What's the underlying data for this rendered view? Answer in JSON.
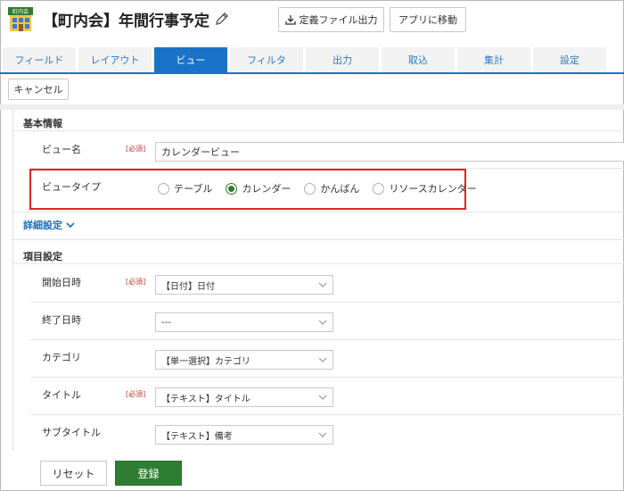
{
  "header": {
    "app_icon_label": "町内会",
    "title": "【町内会】年間行事予定",
    "export_button": "定義ファイル出力",
    "goto_app_button": "アプリに移動"
  },
  "tabs": [
    {
      "label": "フィールド",
      "active": false
    },
    {
      "label": "レイアウト",
      "active": false
    },
    {
      "label": "ビュー",
      "active": true
    },
    {
      "label": "フィルタ",
      "active": false
    },
    {
      "label": "出力",
      "active": false
    },
    {
      "label": "取込",
      "active": false
    },
    {
      "label": "集計",
      "active": false
    },
    {
      "label": "設定",
      "active": false
    }
  ],
  "cancel_button": "キャンセル",
  "basic_info": {
    "section_title": "基本情報",
    "view_name_label": "ビュー名",
    "required": "[必須]",
    "view_name_value": "カレンダービュー",
    "view_type_label": "ビュータイプ",
    "view_type_options": [
      {
        "label": "テーブル",
        "checked": false
      },
      {
        "label": "カレンダー",
        "checked": true
      },
      {
        "label": "かんばん",
        "checked": false
      },
      {
        "label": "リソースカレンダー",
        "checked": false
      }
    ]
  },
  "detail_settings": "詳細設定",
  "item_settings": {
    "section_title": "項目設定",
    "required": "[必須]",
    "fields": [
      {
        "label": "開始日時",
        "required": true,
        "value": "【日付】日付"
      },
      {
        "label": "終了日時",
        "required": false,
        "value": "---"
      },
      {
        "label": "カテゴリ",
        "required": false,
        "value": "【単一選択】カテゴリ"
      },
      {
        "label": "タイトル",
        "required": true,
        "value": "【テキスト】タイトル"
      },
      {
        "label": "サブタイトル",
        "required": false,
        "value": "【テキスト】備考"
      }
    ]
  },
  "footer": {
    "reset_button": "リセット",
    "save_button": "登録"
  },
  "colors": {
    "accent_blue": "#1a73c8",
    "save_green": "#2f7d32",
    "highlight_red": "#e32222",
    "required_red": "#c0392b"
  }
}
